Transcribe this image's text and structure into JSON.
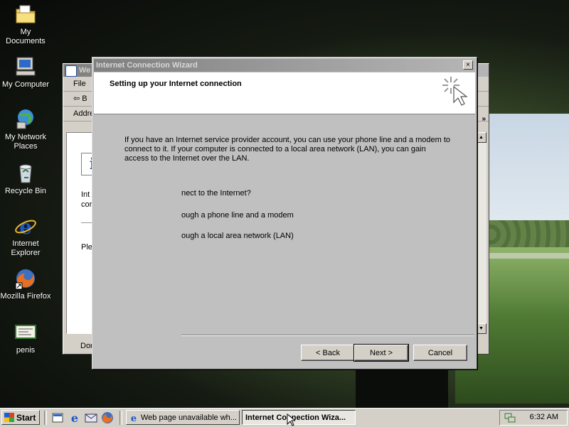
{
  "desktop": {
    "icons": [
      {
        "label": "My Documents",
        "icon": "folder-icon"
      },
      {
        "label": "My Computer",
        "icon": "computer-icon"
      },
      {
        "label": "My Network\nPlaces",
        "icon": "network-icon"
      },
      {
        "label": "Recycle Bin",
        "icon": "recycle-bin-icon"
      },
      {
        "label": "Internet\nExplorer",
        "icon": "ie-icon"
      },
      {
        "label": "Mozilla Firefox",
        "icon": "firefox-icon"
      },
      {
        "label": "penis",
        "icon": "document-icon"
      }
    ]
  },
  "background_window": {
    "title": "We",
    "menu_first": "File",
    "back_label": "B",
    "address_label": "Addre",
    "content_lines": [
      "Int",
      "cor",
      "Ple"
    ],
    "status": "Dor",
    "chevron": "»"
  },
  "wizard": {
    "title": "Internet Connection Wizard",
    "close_glyph": "×",
    "header": "Setting up your Internet connection",
    "intro": "If you have an Internet service provider account, you can use your phone line and a modem to connect to it. If your computer is connected to a local area network (LAN), you can gain access to the Internet over the LAN.",
    "question": "nect to the Internet?",
    "option_phone": "ough a phone line and a modem",
    "option_lan": "ough a local area network (LAN)",
    "back_button": "< Back",
    "next_button": "Next >",
    "cancel_button": "Cancel"
  },
  "taskbar": {
    "start_label": "Start",
    "quick_launch": [
      "show-desktop-icon",
      "ie-icon",
      "outlook-icon",
      "firefox-icon"
    ],
    "tasks": [
      {
        "label": "Web page unavailable wh...",
        "active": false
      },
      {
        "label": "Internet Connection Wiza...",
        "active": true
      }
    ],
    "clock": "6:32 AM"
  },
  "colors": {
    "title_inactive": "#808080",
    "face": "#d4d0c8",
    "dialog_face": "#c0c0c0",
    "ie_blue": "#1c57c8"
  }
}
